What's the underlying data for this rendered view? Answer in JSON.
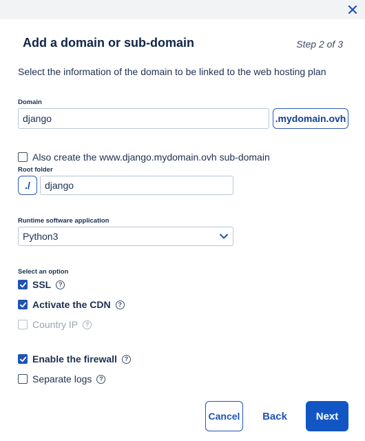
{
  "dialog": {
    "title": "Add a domain or sub-domain",
    "step": "Step 2 of 3",
    "intro": "Select the information of the domain to be linked to the web hosting plan"
  },
  "domain": {
    "label": "Domain",
    "value": "django",
    "suffix": ".mydomain.ovh"
  },
  "www_option": {
    "label": "Also create the www.django.mydomain.ovh sub-domain",
    "checked": false
  },
  "root_folder": {
    "label": "Root folder",
    "prefix": "./",
    "value": "django"
  },
  "runtime": {
    "label": "Runtime software application",
    "selected": "Python3"
  },
  "options": {
    "label": "Select an option",
    "ssl": {
      "label": "SSL",
      "checked": true
    },
    "cdn": {
      "label": "Activate the CDN",
      "checked": true
    },
    "country_ip": {
      "label": "Country IP",
      "checked": false,
      "disabled": true
    },
    "firewall": {
      "label": "Enable the firewall",
      "checked": true
    },
    "separate_logs": {
      "label": "Separate logs",
      "checked": false
    }
  },
  "help_glyph": "?",
  "buttons": {
    "cancel": "Cancel",
    "back": "Back",
    "next": "Next"
  },
  "colors": {
    "accent": "#1f53b5",
    "primary_button": "#1256c4",
    "title": "#0f2547"
  }
}
